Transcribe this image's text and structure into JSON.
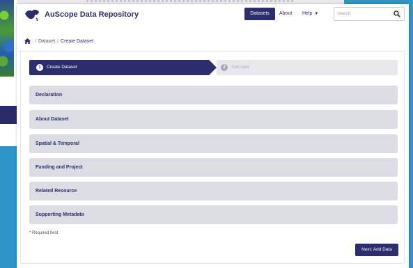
{
  "header": {
    "app_title": "AuScope Data Repository",
    "nav": {
      "datasets": "Datasets",
      "about": "About",
      "help": "Help"
    },
    "search": {
      "placeholder": "Search"
    }
  },
  "breadcrumb": {
    "items": [
      "Dataset",
      "Create Dataset"
    ],
    "separator": "/"
  },
  "stepper": {
    "steps": [
      {
        "number": "1",
        "label": "Create Dataset",
        "active": true
      },
      {
        "number": "2",
        "label": "Add data",
        "active": false
      }
    ]
  },
  "sections": [
    {
      "label": "Declaration"
    },
    {
      "label": "About Dataset"
    },
    {
      "label": "Spatial & Temporal"
    },
    {
      "label": "Funding and Project"
    },
    {
      "label": "Related Resource"
    },
    {
      "label": "Supporting Metadata"
    }
  ],
  "form": {
    "required_note": "* Required field",
    "next_button": "Next: Add Data"
  },
  "colors": {
    "brand": "#2b2d6e",
    "section_bg": "#dcdde2",
    "background": "#2f95c9"
  },
  "icons": {
    "logo": "auscope-logo-icon",
    "home": "home-icon",
    "search": "search-icon",
    "caret": "caret-down-icon"
  }
}
